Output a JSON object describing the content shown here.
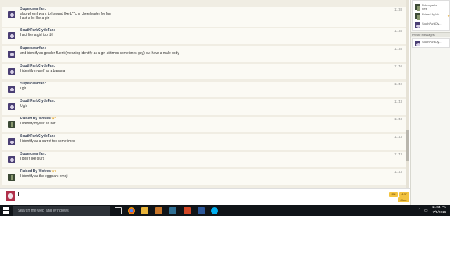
{
  "chat": {
    "messages": [
      {
        "user": "Superdawnfan:",
        "star": false,
        "avatar": "spc",
        "lines": [
          "also when I want to I sound like b**chy cheerleader for fun",
          "I act a lot like a girl"
        ],
        "time": "11:38"
      },
      {
        "user": "SouthParkClydeFan:",
        "star": false,
        "avatar": "spc",
        "lines": [
          "I act like a girl too tbh"
        ],
        "time": "11:38"
      },
      {
        "user": "Superdawnfan:",
        "star": false,
        "avatar": "spc",
        "lines": [
          "and identify as gender fluent (meaning identify as a girl at times sometimes guy) but have a male body"
        ],
        "time": "11:38"
      },
      {
        "user": "SouthParkClydeFan:",
        "star": false,
        "avatar": "spc",
        "lines": [
          "I identify myself as a banana"
        ],
        "time": "11:40"
      },
      {
        "user": "Superdawnfan:",
        "star": false,
        "avatar": "spc",
        "lines": [
          "ugh"
        ],
        "time": "11:40"
      },
      {
        "user": "SouthParkClydeFan:",
        "star": false,
        "avatar": "spc",
        "lines": [
          "Ugh"
        ],
        "time": "11:43"
      },
      {
        "user": "Raised By Wolves",
        "star": true,
        "avatar": "wolf",
        "lines": [
          "I identify myself as hot"
        ],
        "time": "11:43"
      },
      {
        "user": "SouthParkClydeFan:",
        "star": false,
        "avatar": "spc",
        "lines": [
          "I identify as a carrot too sometimes"
        ],
        "time": "11:43"
      },
      {
        "user": "Superdawnfan:",
        "star": false,
        "avatar": "spc",
        "lines": [
          "I don't like slurs"
        ],
        "time": "11:43"
      },
      {
        "user": "Raised By Wolves",
        "star": true,
        "avatar": "wolf",
        "lines": [
          "I identify as the eggplant emoji"
        ],
        "time": "11:43"
      }
    ],
    "star_glyph": "★:",
    "input_value": "",
    "pm_label": "PM",
    "afk_label": "AFK",
    "clear_label": "Clear"
  },
  "sidebar": {
    "users": [
      {
        "label": "Nobody else\nhere",
        "avatar": "wolf",
        "star": false
      },
      {
        "label": "Raised By Wo...",
        "avatar": "wolf",
        "star": true
      },
      {
        "label": "SouthParkCly...",
        "avatar": "spc",
        "star": false
      }
    ],
    "private_header": "Private Messages",
    "private_items": [
      {
        "label": "SouthParkCly...",
        "avatar": "spc"
      }
    ]
  },
  "taskbar": {
    "search_placeholder": "Search the web and Windows",
    "time": "11:44 PM",
    "date": "7/5/2016",
    "icons": [
      "task-view-icon",
      "chrome-icon",
      "file-explorer-icon",
      "media-icon",
      "photo-icon",
      "powerpoint-icon",
      "word-icon",
      "skype-icon"
    ]
  },
  "colors": {
    "accent_button": "#f3c33f",
    "taskbar": "#101418",
    "chat_bg": "#f0ede3"
  }
}
